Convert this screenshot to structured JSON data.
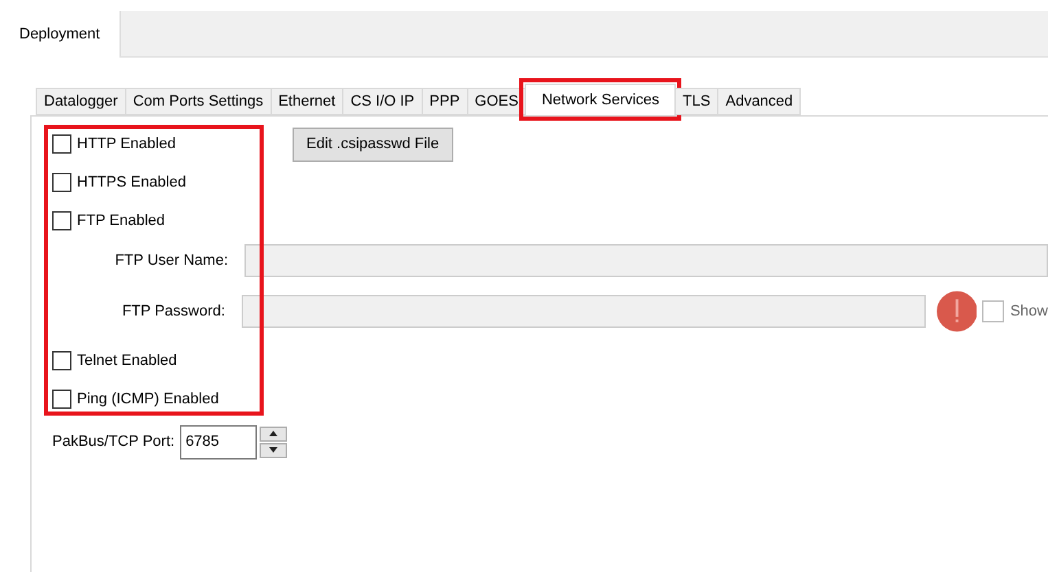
{
  "top_tabs": [
    {
      "label": "Deployment",
      "selected": true
    }
  ],
  "tabs": [
    {
      "label": "Datalogger",
      "selected": false,
      "highlighted": false
    },
    {
      "label": "Com Ports Settings",
      "selected": false,
      "highlighted": false
    },
    {
      "label": "Ethernet",
      "selected": false,
      "highlighted": false
    },
    {
      "label": "CS I/O IP",
      "selected": false,
      "highlighted": false
    },
    {
      "label": "PPP",
      "selected": false,
      "highlighted": false
    },
    {
      "label": "GOES",
      "selected": false,
      "highlighted": false
    },
    {
      "label": "Network Services",
      "selected": true,
      "highlighted": true
    },
    {
      "label": "TLS",
      "selected": false,
      "highlighted": false
    },
    {
      "label": "Advanced",
      "selected": false,
      "highlighted": false
    }
  ],
  "services": {
    "highlighted": true,
    "rows": [
      {
        "kind": "checkbox",
        "label": "HTTP Enabled",
        "checked": false,
        "button": "Edit .csipasswd File"
      },
      {
        "kind": "checkbox",
        "label": "HTTPS Enabled",
        "checked": false
      },
      {
        "kind": "checkbox",
        "label": "FTP Enabled",
        "checked": false
      },
      {
        "kind": "field",
        "label": "FTP User Name:",
        "disabled": true
      },
      {
        "kind": "password",
        "label": "FTP Password:",
        "disabled": true,
        "warning": true,
        "show_label": "Show",
        "show_checked": false
      },
      {
        "kind": "checkbox",
        "label": "Telnet Enabled",
        "checked": false
      },
      {
        "kind": "checkbox",
        "label": "Ping (ICMP) Enabled",
        "checked": false
      }
    ]
  },
  "port": {
    "label": "PakBus/TCP Port:",
    "value": "6785"
  }
}
